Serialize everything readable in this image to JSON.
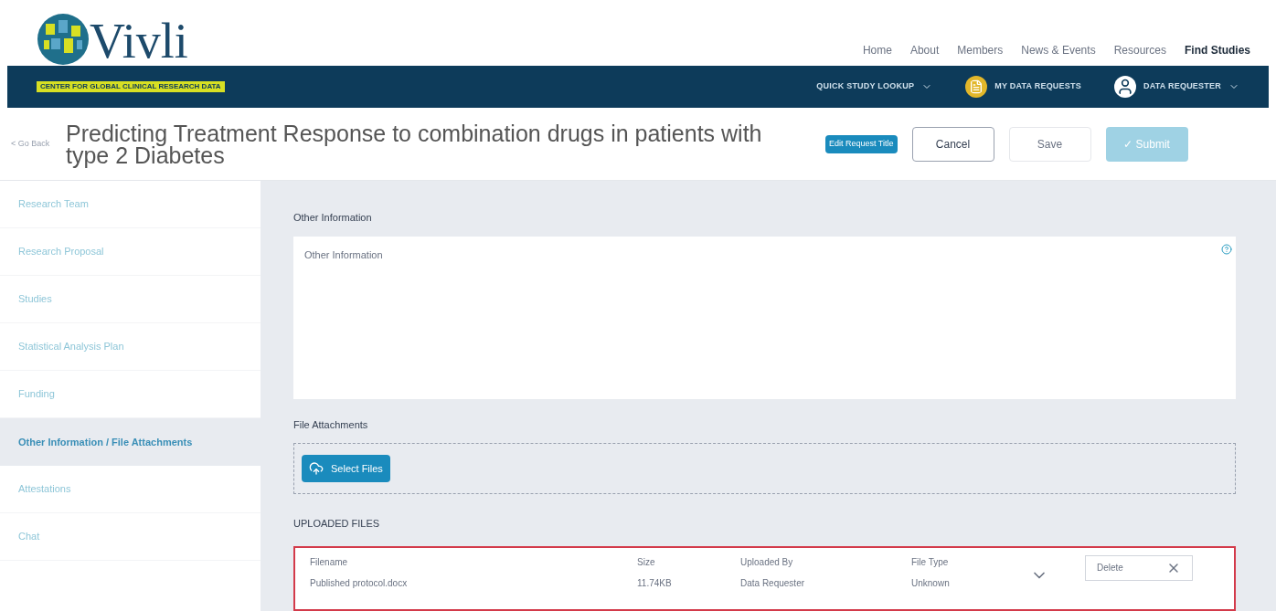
{
  "logo": {
    "name": "Vivli",
    "tagline": "CENTER FOR GLOBAL CLINICAL RESEARCH DATA"
  },
  "top_nav": [
    {
      "label": "Home",
      "selected": false
    },
    {
      "label": "About",
      "selected": false
    },
    {
      "label": "Members",
      "selected": false
    },
    {
      "label": "News & Events",
      "selected": false
    },
    {
      "label": "Resources",
      "selected": false
    },
    {
      "label": "Find Studies",
      "selected": true
    }
  ],
  "sub_nav": [
    {
      "kind": "dropdown",
      "label": "QUICK STUDY LOOKUP"
    },
    {
      "kind": "requests",
      "label": "MY DATA REQUESTS"
    },
    {
      "kind": "user",
      "label": "DATA REQUESTER"
    }
  ],
  "back_link": "< Go Back",
  "title": "Predicting Treatment Response to combination drugs in patients with type 2 Diabetes",
  "actions": [
    {
      "kind": "badge",
      "label": "Edit Request Title"
    },
    {
      "kind": "outline",
      "label": "Cancel",
      "disabled": false
    },
    {
      "kind": "outline",
      "label": "Save",
      "disabled": true
    },
    {
      "kind": "primary",
      "label": "✓ Submit",
      "disabled": true
    }
  ],
  "sidebar": {
    "items": [
      {
        "label": "Research Team",
        "selected": false
      },
      {
        "label": "Research Proposal",
        "selected": false
      },
      {
        "label": "Studies",
        "selected": false
      },
      {
        "label": "Statistical Analysis Plan",
        "selected": false
      },
      {
        "label": "Funding",
        "selected": false
      },
      {
        "label": "Other Information / File Attachments",
        "selected": true
      },
      {
        "label": "Attestations",
        "selected": false
      },
      {
        "label": "Chat",
        "selected": false
      }
    ]
  },
  "other_information": {
    "heading": "Other Information",
    "placeholder": "Other Information"
  },
  "file_attachments": {
    "heading": "File Attachments",
    "button": "Select Files"
  },
  "uploaded_files": {
    "heading": "UPLOADED FILES",
    "columns": [
      "Filename",
      "Size",
      "Uploaded By",
      "File Type"
    ],
    "rows": [
      {
        "filename": "Published protocol.docx",
        "size": "11.74KB",
        "uploaded_by": "Data Requester",
        "file_type": "Unknown",
        "action": "Delete"
      }
    ]
  }
}
